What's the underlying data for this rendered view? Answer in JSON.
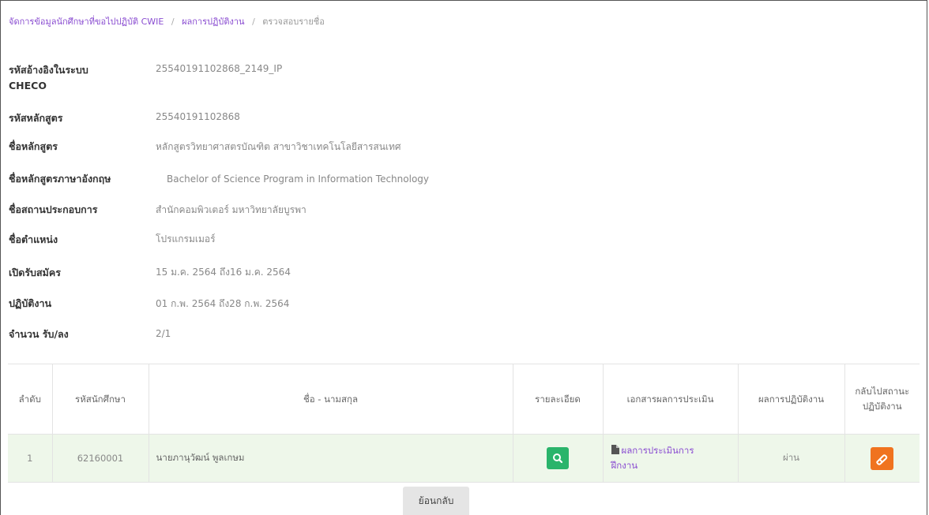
{
  "breadcrumb": {
    "items": [
      "จัดการข้อมูลนักศึกษาที่ขอไปปฏิบัติ CWIE",
      "ผลการปฏิบัติงาน",
      "ตรวจสอบรายชื่อ"
    ],
    "separator": "/"
  },
  "info": {
    "checo_id_label_line1": "รหัสอ้างอิงในระบบ",
    "checo_id_label_line2": "CHECO",
    "checo_id_value": "25540191102868_2149_IP",
    "program_code_label": "รหัสหลักสูตร",
    "program_code_value": "25540191102868",
    "program_name_label": "ชื่อหลักสูตร",
    "program_name_value": "หลักสูตรวิทยาศาสตรบัณฑิต สาขาวิชาเทคโนโลยีสารสนเทศ",
    "program_name_en_label": "ชื่อหลักสูตรภาษาอังกฤษ",
    "program_name_en_value": "Bachelor of Science Program in Information Technology",
    "workplace_label": "ชื่อสถานประกอบการ",
    "workplace_value": "สำนักคอมพิวเตอร์ มหาวิทยาลัยบูรพา",
    "position_label": "ชื่อตำแหน่ง",
    "position_value": "โปรแกรมเมอร์",
    "application_period_label": "เปิดรับสมัคร",
    "application_period_value": "15 ม.ค. 2564 ถึง16 ม.ค. 2564",
    "work_period_label": "ปฏิบัติงาน",
    "work_period_value": "01 ก.พ. 2564 ถึง28 ก.พ. 2564",
    "quota_label": "จำนวน รับ/ลง",
    "quota_value": "2/1"
  },
  "table": {
    "headers": {
      "no": "ลำดับ",
      "student_id": "รหัสนักศึกษา",
      "name": "ชื่อ - นามสกุล",
      "details": "รายละเอียด",
      "doc": "เอกสารผลการประเมิน",
      "result": "ผลการปฏิบัติงาน",
      "back_line1": "กลับไปสถานะ",
      "back_line2": "ปฏิบัติงาน"
    },
    "rows": [
      {
        "no": "1",
        "student_id": "62160001",
        "name": "นายภานุวัฒน์ พูลเกษม",
        "doc_link_line1": "ผลการประเมินการ",
        "doc_link_line2": "ฝึกงาน",
        "result": "ผ่าน"
      }
    ]
  },
  "icons": {
    "view": "search-icon",
    "doc": "file-icon",
    "edit": "eraser-icon"
  },
  "colors": {
    "link": "#8a4dd1",
    "view_button": "#2ab46b",
    "edit_button": "#f0731f",
    "row_background": "#eef7ea"
  },
  "back_button_label": "ย้อนกลับ"
}
